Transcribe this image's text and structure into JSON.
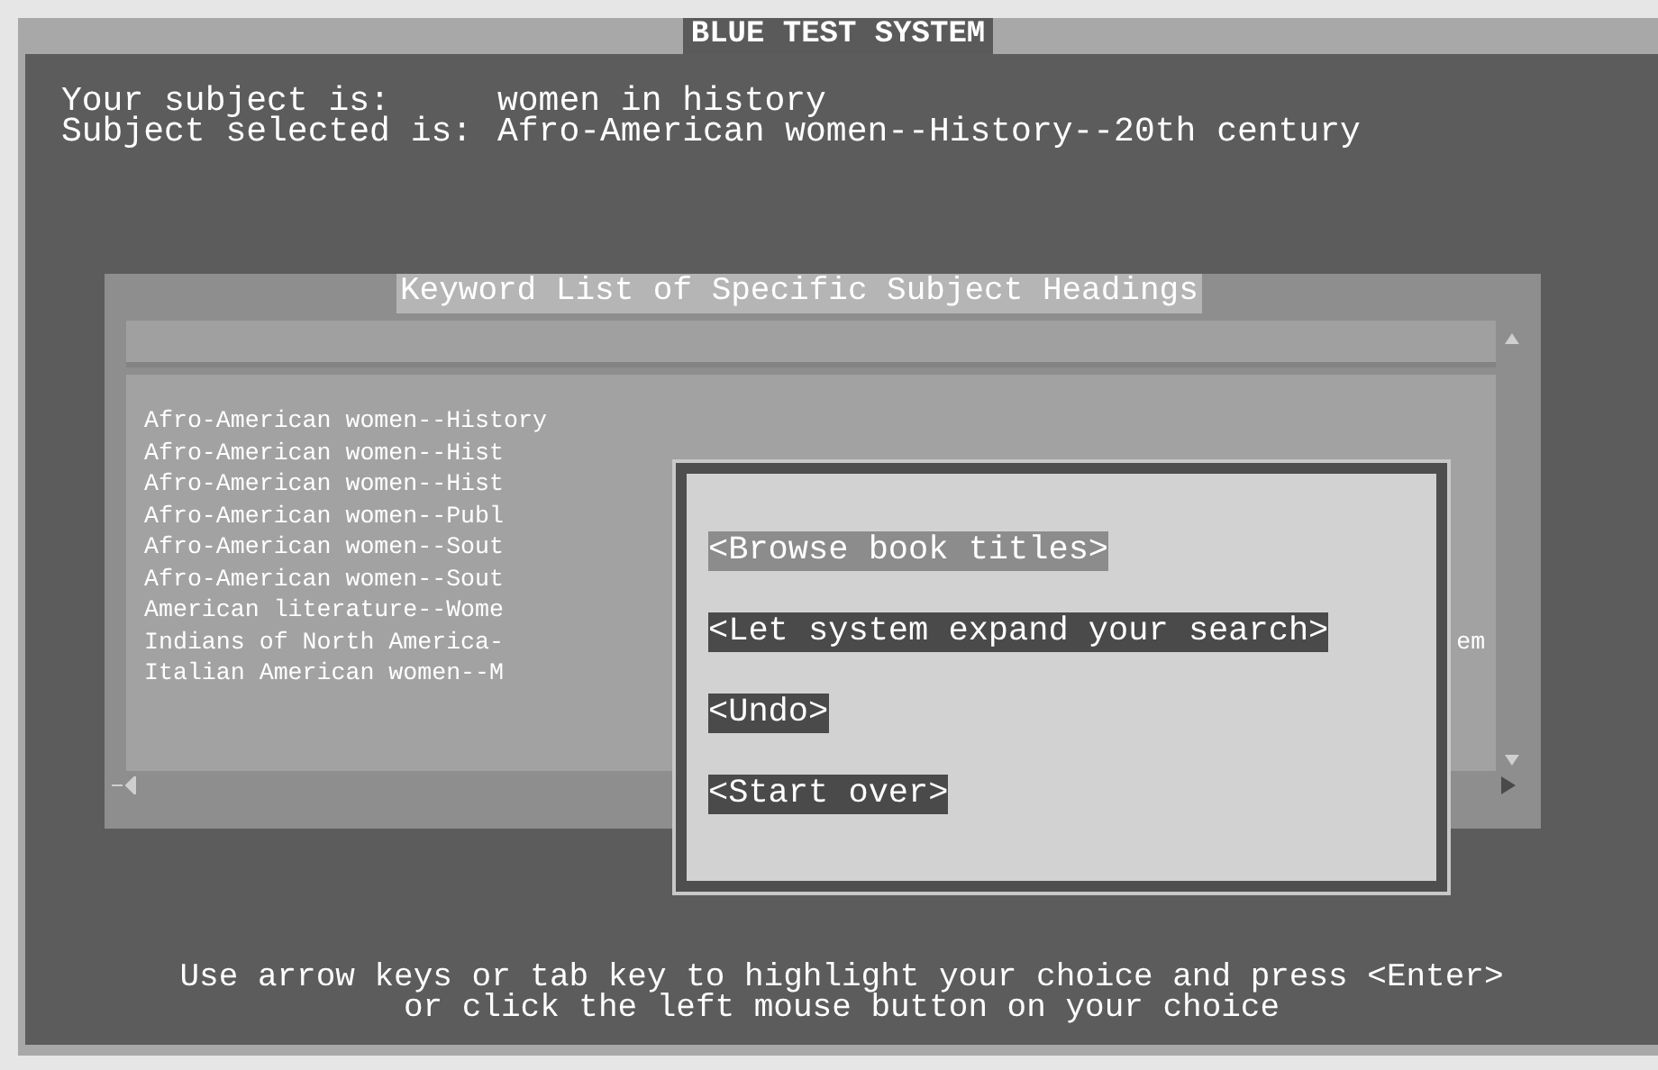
{
  "window": {
    "title": "BLUE TEST SYSTEM"
  },
  "subject": [
    {
      "label": "Your subject is:",
      "value": "women in history"
    },
    {
      "label": "Subject selected is:",
      "value": "Afro-American women--History--20th century"
    }
  ],
  "keyword_list": {
    "title": "Keyword List of Specific Subject Headings",
    "items": [
      {
        "text": "Afro-American women--History"
      },
      {
        "text": "Afro-American women--Hist"
      },
      {
        "text": "Afro-American women--Hist"
      },
      {
        "text": "Afro-American women--Publ"
      },
      {
        "text": "Afro-American women--Sout"
      },
      {
        "text": "Afro-American women--Sout"
      },
      {
        "text": "American literature--Wome"
      },
      {
        "text": "Indians of North America-",
        "tail": "em"
      },
      {
        "text": "Italian American women--M"
      }
    ]
  },
  "dialog": {
    "options": [
      {
        "label": "<Browse book titles>",
        "selected": true
      },
      {
        "label": "<Let system expand your search>",
        "selected": false
      },
      {
        "label": "<Undo>",
        "selected": false
      },
      {
        "label": "<Start over>",
        "selected": false
      }
    ]
  },
  "instructions": [
    "Use arrow keys or tab key to highlight your choice and press <Enter>",
    "or click the left mouse button on your choice"
  ]
}
